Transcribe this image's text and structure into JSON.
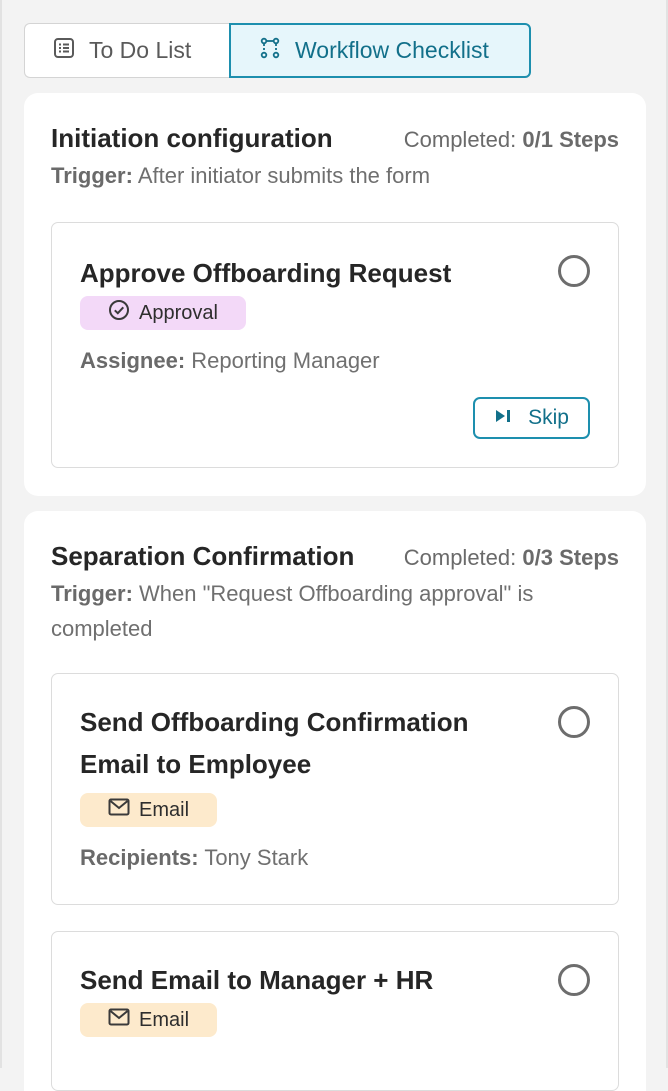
{
  "tabs": [
    {
      "label": "To Do List",
      "icon": "list-icon",
      "active": false
    },
    {
      "label": "Workflow Checklist",
      "icon": "workflow-icon",
      "active": true
    }
  ],
  "sections": [
    {
      "title": "Initiation configuration",
      "completed_label": "Completed:",
      "completed_value": "0/1 Steps",
      "trigger_label": "Trigger:",
      "trigger_text": "After initiator submits the form",
      "cards": [
        {
          "title": "Approve Offboarding Request",
          "badge": "Approval",
          "badge_icon": "check-circle-icon",
          "meta_label": "Assignee:",
          "meta_value": "Reporting Manager",
          "action": "Skip"
        }
      ]
    },
    {
      "title": "Separation Confirmation",
      "completed_label": "Completed:",
      "completed_value": "0/3 Steps",
      "trigger_label": "Trigger:",
      "trigger_text": "When \"Request Offboarding approval\" is completed",
      "cards": [
        {
          "title": "Send Offboarding Confirmation Email to Employee",
          "badge": "Email",
          "badge_icon": "mail-icon",
          "meta_label": "Recipients:",
          "meta_value": "Tony Stark"
        },
        {
          "title": "Send Email to Manager + HR",
          "badge": "Email",
          "badge_icon": "mail-icon"
        }
      ]
    }
  ],
  "colors": {
    "accent": "#1d8fae",
    "approval_badge": "#f3d9f8",
    "email_badge": "#fdeacc",
    "background": "#f3f3f3"
  }
}
